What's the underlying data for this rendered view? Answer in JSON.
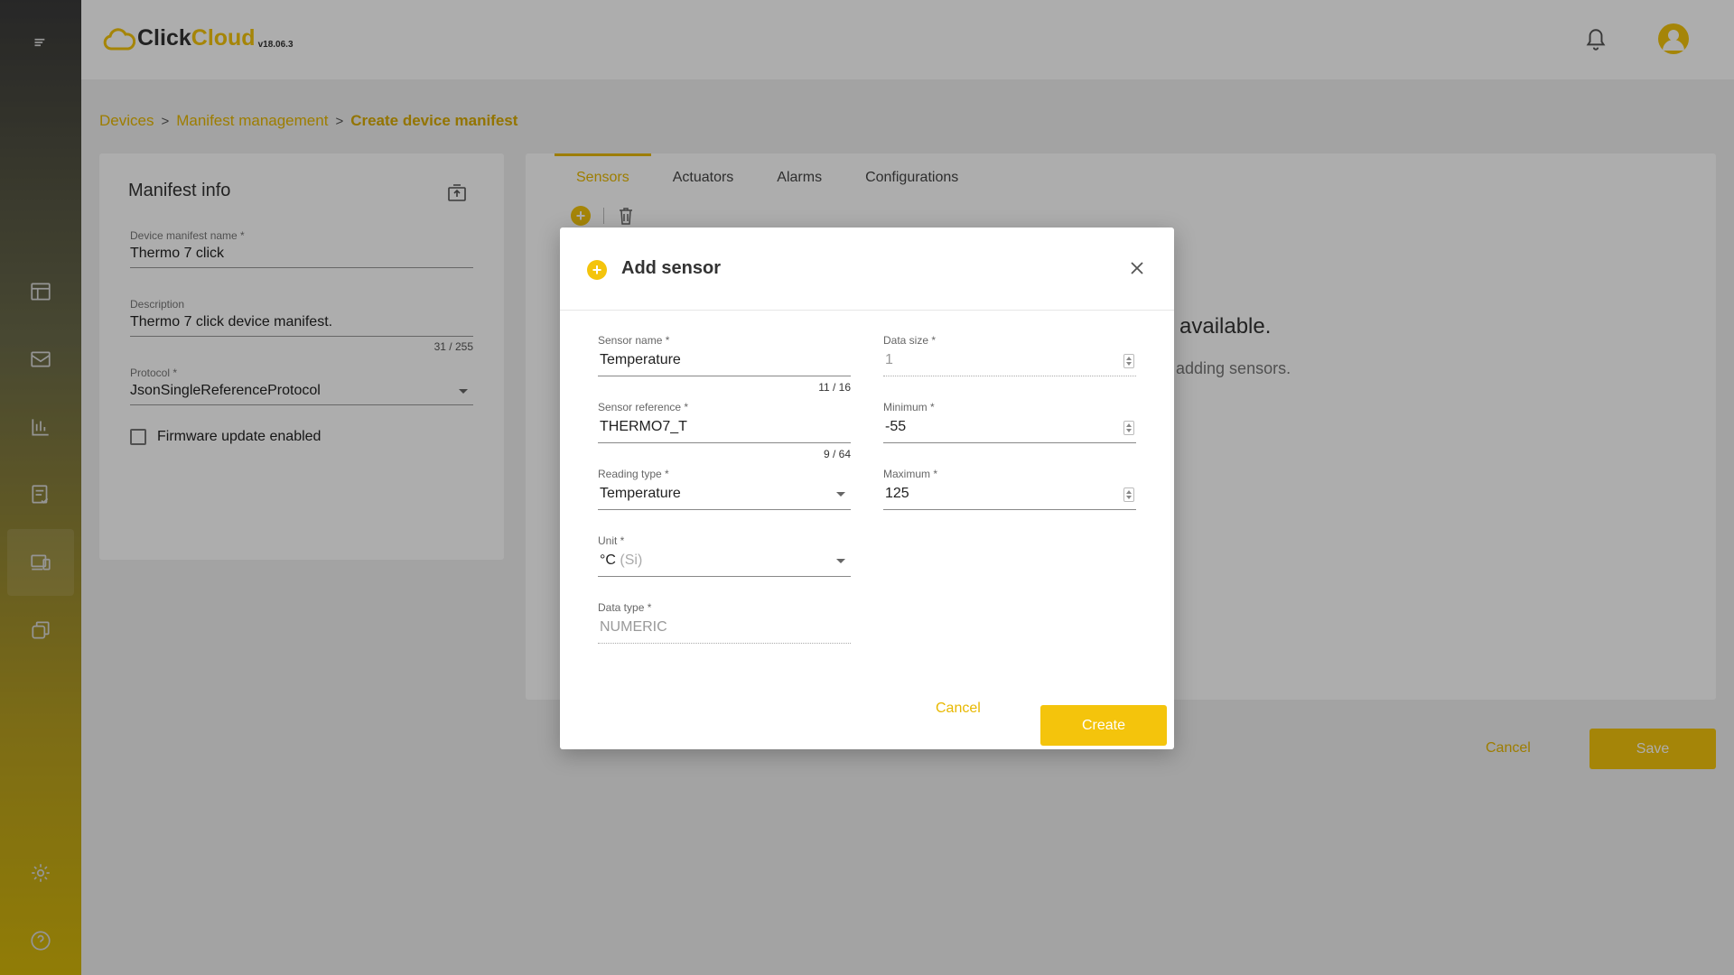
{
  "sidebar": {
    "items": [
      {
        "icon": "menu-icon"
      },
      {
        "icon": "dashboard-icon"
      },
      {
        "icon": "mail-icon"
      },
      {
        "icon": "analytics-icon"
      },
      {
        "icon": "checklist-icon"
      },
      {
        "icon": "devices-icon"
      },
      {
        "icon": "copy-icon"
      },
      {
        "icon": "gear-icon"
      },
      {
        "icon": "help-icon"
      }
    ]
  },
  "header": {
    "logo_click": "Click",
    "logo_cloud": "Cloud",
    "version": "v18.06.3"
  },
  "breadcrumb": {
    "items": [
      "Devices",
      "Manifest management"
    ],
    "current": "Create device manifest",
    "separator": ">"
  },
  "manifest_info": {
    "title": "Manifest info",
    "name_label": "Device manifest name *",
    "name_value": "Thermo 7 click",
    "description_label": "Description",
    "description_value": "Thermo 7 click device manifest.",
    "description_counter": "31 / 255",
    "protocol_label": "Protocol *",
    "protocol_value": "JsonSingleReferenceProtocol",
    "firmware_label": "Firmware update enabled"
  },
  "main": {
    "tabs": [
      "Sensors",
      "Actuators",
      "Alarms",
      "Configurations"
    ],
    "active_tab": "Sensors",
    "empty_title": "available.",
    "empty_subtitle": "adding sensors.",
    "cancel_label": "Cancel",
    "save_label": "Save"
  },
  "dialog": {
    "title": "Add sensor",
    "sensor_name_label": "Sensor name *",
    "sensor_name_value": "Temperature",
    "sensor_name_counter": "11 / 16",
    "sensor_reference_label": "Sensor reference *",
    "sensor_reference_value": "THERMO7_T",
    "sensor_reference_counter": "9 / 64",
    "reading_type_label": "Reading type *",
    "reading_type_value": "Temperature",
    "unit_label": "Unit *",
    "unit_value": "°C",
    "unit_system": "(Si)",
    "data_type_label": "Data type *",
    "data_type_value": "NUMERIC",
    "data_size_label": "Data size *",
    "data_size_value": "1",
    "minimum_label": "Minimum *",
    "minimum_value": "-55",
    "maximum_label": "Maximum *",
    "maximum_value": "125",
    "cancel_label": "Cancel",
    "create_label": "Create"
  },
  "colors": {
    "accent": "#f4c40c",
    "accent_text": "#e8b800",
    "overlay": "rgba(0,0,0,0.32)"
  }
}
